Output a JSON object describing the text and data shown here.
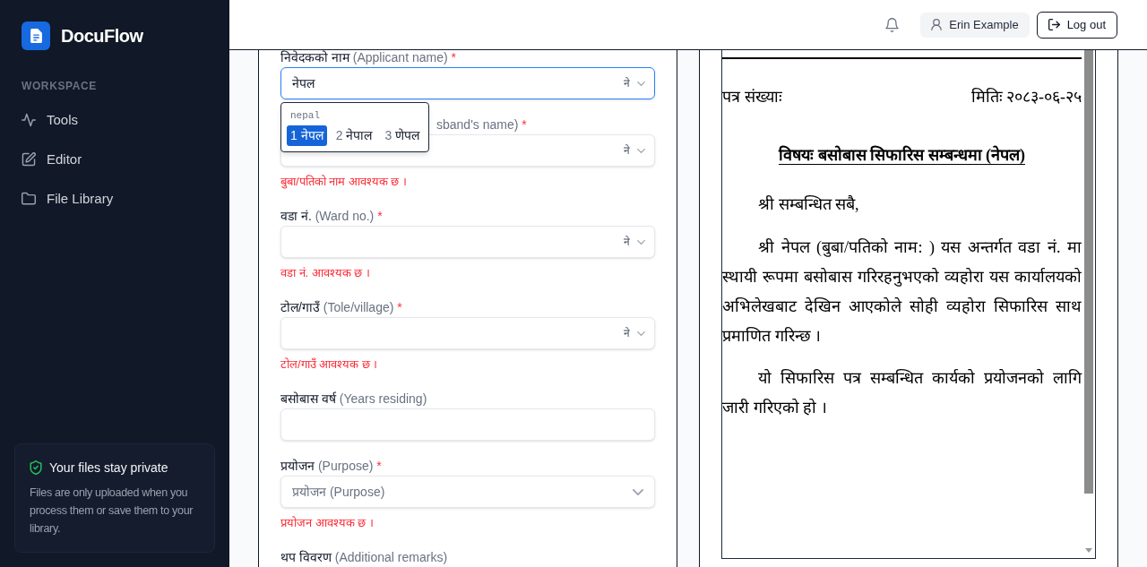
{
  "sidebar": {
    "brand": "DocuFlow",
    "section": "WORKSPACE",
    "items": [
      {
        "label": "Tools"
      },
      {
        "label": "Editor"
      },
      {
        "label": "File Library"
      }
    ],
    "privacy_card": {
      "title": "Your files stay private",
      "text": "Files are only uploaded when you process them or save them to your library."
    }
  },
  "header": {
    "user": "Erin Example",
    "logout": "Log out"
  },
  "form": {
    "fields": [
      {
        "kind": "ime_input",
        "label": "निवेदकको नाम",
        "hint": "(Applicant name)",
        "mark": "*",
        "value": "नेपल",
        "ime": "ने",
        "focused": true,
        "suggestions": {
          "query": "nepal",
          "candidates": [
            {
              "number": "1",
              "text": "नेपल",
              "selected": true
            },
            {
              "number": "2",
              "text": "नेपाल",
              "selected": false
            },
            {
              "number": "3",
              "text": "णेपल",
              "selected": false
            }
          ]
        }
      },
      {
        "kind": "ime_input",
        "hint": "sband's name)",
        "mark": "*",
        "ime": "ने",
        "focused": false,
        "error": "बुबा/पतिको नाम आवश्यक छ ।"
      },
      {
        "kind": "ime_input",
        "label": "वडा नं.",
        "hint": "(Ward no.)",
        "mark": "*",
        "ime": "ने",
        "focused": false,
        "error": "वडा नं. आवश्यक छ ।"
      },
      {
        "kind": "ime_input",
        "label": "टोल/गाउँ",
        "hint": "(Tole/village)",
        "mark": "*",
        "ime": "ने",
        "focused": false,
        "error": "टोल/गाउँ आवश्यक छ ।"
      },
      {
        "kind": "text_input",
        "label": "बसोबास वर्ष",
        "hint": "(Years residing)",
        "focused": false
      },
      {
        "kind": "select",
        "label": "प्रयोजन",
        "hint": "(Purpose)",
        "mark": "*",
        "placeholder": "प्रयोजन (Purpose)",
        "focused": false,
        "error": "प्रयोजन आवश्यक छ ।"
      },
      {
        "kind": "label",
        "label": "थप विवरण",
        "hint": "(Additional remarks)"
      }
    ]
  },
  "preview": {
    "ref_label": "पत्र संख्याः",
    "date": "मितिः २०८३-०६-२५",
    "subject": "विषयः बसोबास सिफारिस सम्बन्धमा (नेपल)",
    "salutation": "श्री सम्बन्धित सबै,",
    "paragraphs": [
      "श्री नेपल (बुबा/पतिको नाम: ) यस अन्तर्गत वडा नं. मा स्थायी रूपमा बसोबास गरिरहनुभएको व्यहोरा यस कार्यालयको अभिलेखबाट देखिन आएकोले सोही व्यहोरा सिफारिस साथ प्रमाणित गरिन्छ ।",
      "यो सिफारिस पत्र सम्बन्धित कार्यको प्रयोजनको लागि जारी गरिएको हो ।"
    ]
  }
}
